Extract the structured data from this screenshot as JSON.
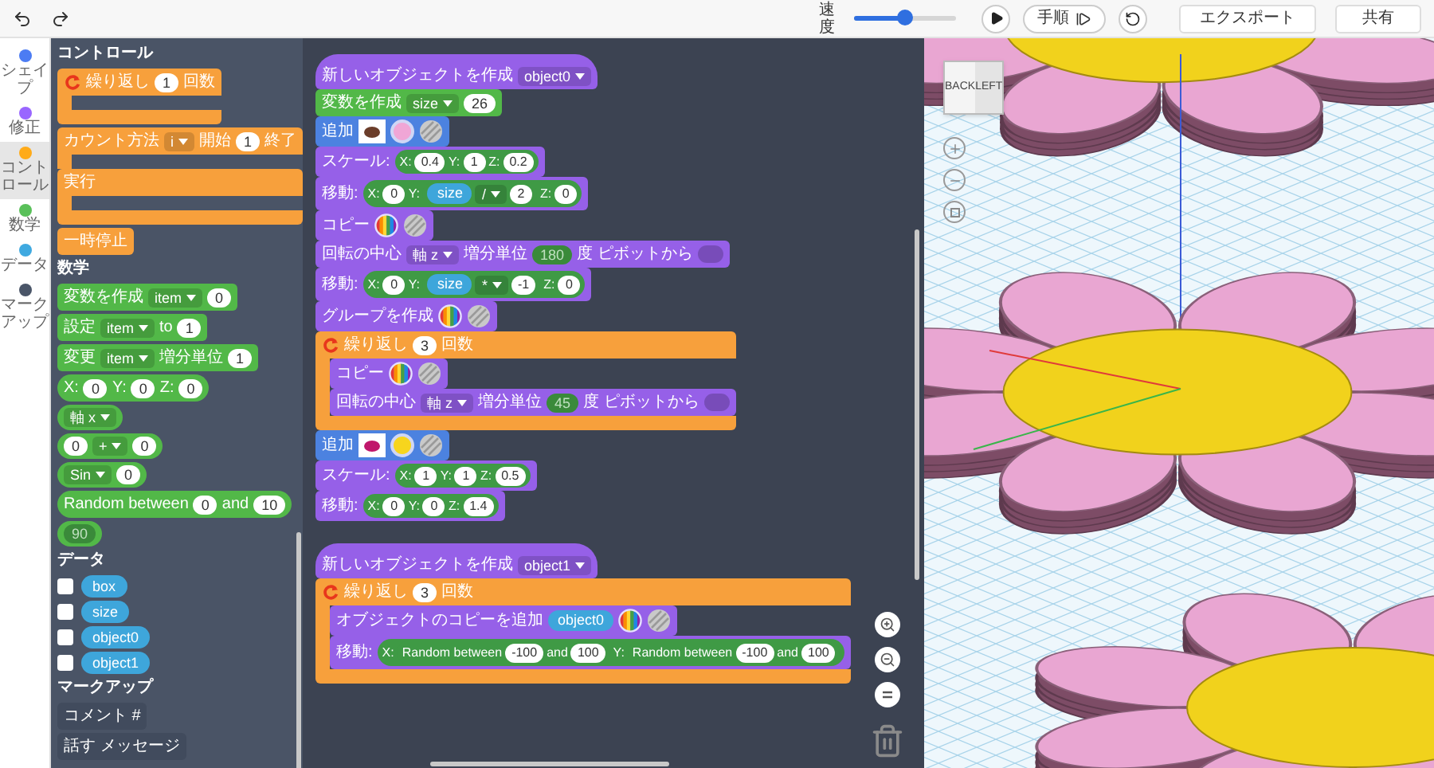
{
  "toolbar": {
    "speed_label": "速度",
    "speed": {
      "level": 0.5
    },
    "step_button": "手順",
    "export_button": "エクスポート",
    "share_button": "共有"
  },
  "categories": [
    {
      "label": "シェイプ",
      "color": "#4c7cf3",
      "selected": false
    },
    {
      "label": "修正",
      "color": "#9966ff",
      "selected": false
    },
    {
      "label": "コントロール",
      "color": "#ffab19",
      "selected": true
    },
    {
      "label": "数学",
      "color": "#59c059",
      "selected": false
    },
    {
      "label": "データ",
      "color": "#3fa9e0",
      "selected": false
    },
    {
      "label": "マークアップ",
      "color": "#4a5568",
      "selected": false
    }
  ],
  "flyout": {
    "sections": [
      {
        "title": "コントロール",
        "items": [
          {
            "kind": "c",
            "color": "#f7a03c",
            "sections": [
              {
                "parts": [
                  {
                    "kind": "loop"
                  },
                  {
                    "kind": "label",
                    "text": "繰り返し"
                  },
                  {
                    "kind": "num",
                    "text": "1"
                  },
                  {
                    "kind": "label",
                    "text": "回数"
                  }
                ]
              }
            ]
          },
          {
            "kind": "c",
            "color": "#f7a03c",
            "sections": [
              {
                "parts": [
                  {
                    "kind": "label",
                    "text": "カウント方法"
                  },
                  {
                    "kind": "dropdown",
                    "text": "i"
                  },
                  {
                    "kind": "label",
                    "text": "開始"
                  },
                  {
                    "kind": "num",
                    "text": "1"
                  },
                  {
                    "kind": "label",
                    "text": "終了"
                  }
                ]
              },
              {
                "parts": [
                  {
                    "kind": "label",
                    "text": "実行"
                  }
                ]
              }
            ]
          },
          {
            "kind": "stack",
            "color": "#f7a03c",
            "parts": [
              {
                "kind": "label",
                "text": "一時停止"
              }
            ]
          }
        ]
      },
      {
        "title": "数学",
        "items": [
          {
            "kind": "stack",
            "color": "#52b848",
            "parts": [
              {
                "kind": "label",
                "text": "変数を作成"
              },
              {
                "kind": "dropdown",
                "text": "item"
              },
              {
                "kind": "num",
                "text": "0"
              }
            ]
          },
          {
            "kind": "stack",
            "color": "#52b848",
            "parts": [
              {
                "kind": "label",
                "text": "設定"
              },
              {
                "kind": "dropdown",
                "text": "item"
              },
              {
                "kind": "label",
                "text": "to"
              },
              {
                "kind": "num",
                "text": "1"
              }
            ]
          },
          {
            "kind": "stack",
            "color": "#52b848",
            "parts": [
              {
                "kind": "label",
                "text": "変更"
              },
              {
                "kind": "dropdown",
                "text": "item"
              },
              {
                "kind": "label",
                "text": "増分単位"
              },
              {
                "kind": "num",
                "text": "1"
              }
            ]
          },
          {
            "kind": "reporter",
            "color": "#52b848",
            "parts": [
              {
                "kind": "label",
                "text": "X:"
              },
              {
                "kind": "num",
                "text": "0"
              },
              {
                "kind": "label",
                "text": "Y:"
              },
              {
                "kind": "num",
                "text": "0"
              },
              {
                "kind": "label",
                "text": "Z:"
              },
              {
                "kind": "num",
                "text": "0"
              }
            ]
          },
          {
            "kind": "reporter",
            "color": "#52b848",
            "parts": [
              {
                "kind": "dropdown",
                "text": "軸 x"
              }
            ]
          },
          {
            "kind": "reporter",
            "color": "#52b848",
            "parts": [
              {
                "kind": "num",
                "text": "0"
              },
              {
                "kind": "dropdown",
                "text": "+"
              },
              {
                "kind": "num",
                "text": "0"
              }
            ]
          },
          {
            "kind": "reporter",
            "color": "#52b848",
            "parts": [
              {
                "kind": "dropdown",
                "text": "Sin"
              },
              {
                "kind": "num",
                "text": "0"
              }
            ]
          },
          {
            "kind": "reporter",
            "color": "#52b848",
            "parts": [
              {
                "kind": "label",
                "text": "Random between"
              },
              {
                "kind": "num",
                "text": "0"
              },
              {
                "kind": "label",
                "text": "and"
              },
              {
                "kind": "num",
                "text": "10"
              }
            ]
          },
          {
            "kind": "reporter",
            "color": "#52b848",
            "parts": [
              {
                "kind": "dnum",
                "text": "90"
              }
            ]
          }
        ]
      },
      {
        "title": "データ",
        "items": [
          {
            "kind": "variable",
            "checked": false,
            "name": "box"
          },
          {
            "kind": "variable",
            "checked": false,
            "name": "size"
          },
          {
            "kind": "variable",
            "checked": false,
            "name": "object0"
          },
          {
            "kind": "variable",
            "checked": false,
            "name": "object1"
          }
        ]
      },
      {
        "title": "マークアップ",
        "items": [
          {
            "kind": "stack",
            "color": "#414b5d",
            "parts": [
              {
                "kind": "label",
                "text": "コメント #"
              }
            ]
          },
          {
            "kind": "stack",
            "color": "#414b5d",
            "parts": [
              {
                "kind": "label",
                "text": "話す"
              },
              {
                "kind": "label",
                "text": "メッセージ"
              }
            ]
          }
        ]
      }
    ]
  },
  "workspace": {
    "stacks": [
      {
        "blocks": [
          {
            "kind": "hat",
            "color": "#9660e8",
            "parts": [
              {
                "kind": "label",
                "text": "新しいオブジェクトを作成"
              },
              {
                "kind": "dropdown",
                "text": "object0"
              }
            ]
          },
          {
            "kind": "stack",
            "color": "#52b848",
            "parts": [
              {
                "kind": "label",
                "text": "変数を作成"
              },
              {
                "kind": "dropdown",
                "text": "size"
              },
              {
                "kind": "num",
                "text": "26"
              }
            ]
          },
          {
            "kind": "stack",
            "color": "#4c82e0",
            "parts": [
              {
                "kind": "label",
                "text": "追加"
              },
              {
                "kind": "thumb",
                "color": "#6b3d2a"
              },
              {
                "kind": "color",
                "color": "#f0a6d6"
              },
              {
                "kind": "hatch"
              }
            ]
          },
          {
            "kind": "stack",
            "color": "#9660e8",
            "parts": [
              {
                "kind": "label",
                "text": "スケール:"
              },
              {
                "kind": "group",
                "parts": [
                  {
                    "kind": "label",
                    "text": "X:"
                  },
                  {
                    "kind": "num",
                    "text": "0.4"
                  },
                  {
                    "kind": "label",
                    "text": "Y:"
                  },
                  {
                    "kind": "num",
                    "text": "1"
                  },
                  {
                    "kind": "label",
                    "text": "Z:"
                  },
                  {
                    "kind": "num",
                    "text": "0.2"
                  }
                ]
              }
            ]
          },
          {
            "kind": "stack",
            "color": "#9660e8",
            "parts": [
              {
                "kind": "label",
                "text": "移動:"
              },
              {
                "kind": "group",
                "parts": [
                  {
                    "kind": "label",
                    "text": "X:"
                  },
                  {
                    "kind": "num",
                    "text": "0"
                  },
                  {
                    "kind": "label",
                    "text": "Y:"
                  },
                  {
                    "kind": "group",
                    "parts": [
                      {
                        "kind": "var",
                        "text": "size"
                      },
                      {
                        "kind": "dropdown",
                        "text": "/"
                      },
                      {
                        "kind": "num",
                        "text": "2"
                      }
                    ]
                  },
                  {
                    "kind": "label",
                    "text": "Z:"
                  },
                  {
                    "kind": "num",
                    "text": "0"
                  }
                ]
              }
            ]
          },
          {
            "kind": "stack",
            "color": "#9660e8",
            "parts": [
              {
                "kind": "label",
                "text": "コピー"
              },
              {
                "kind": "rainbow"
              },
              {
                "kind": "hatch"
              }
            ]
          },
          {
            "kind": "stack",
            "color": "#9660e8",
            "parts": [
              {
                "kind": "label",
                "text": "回転の中心"
              },
              {
                "kind": "dropdown",
                "text": "軸 z"
              },
              {
                "kind": "label",
                "text": "増分単位"
              },
              {
                "kind": "dnum",
                "text": "180"
              },
              {
                "kind": "label",
                "text": "度"
              },
              {
                "kind": "label",
                "text": "ピボットから"
              },
              {
                "kind": "slot"
              }
            ]
          },
          {
            "kind": "stack",
            "color": "#9660e8",
            "parts": [
              {
                "kind": "label",
                "text": "移動:"
              },
              {
                "kind": "group",
                "parts": [
                  {
                    "kind": "label",
                    "text": "X:"
                  },
                  {
                    "kind": "num",
                    "text": "0"
                  },
                  {
                    "kind": "label",
                    "text": "Y:"
                  },
                  {
                    "kind": "group",
                    "parts": [
                      {
                        "kind": "var",
                        "text": "size"
                      },
                      {
                        "kind": "dropdown",
                        "text": "*"
                      },
                      {
                        "kind": "num",
                        "text": "-1"
                      }
                    ]
                  },
                  {
                    "kind": "label",
                    "text": "Z:"
                  },
                  {
                    "kind": "num",
                    "text": "0"
                  }
                ]
              }
            ]
          },
          {
            "kind": "stack",
            "color": "#9660e8",
            "parts": [
              {
                "kind": "label",
                "text": "グループを作成"
              },
              {
                "kind": "rainbow"
              },
              {
                "kind": "hatch"
              }
            ]
          },
          {
            "kind": "c",
            "color": "#f7a03c",
            "sections": [
              {
                "parts": [
                  {
                    "kind": "loop"
                  },
                  {
                    "kind": "label",
                    "text": "繰り返し"
                  },
                  {
                    "kind": "num",
                    "text": "3"
                  },
                  {
                    "kind": "label",
                    "text": "回数"
                  }
                ],
                "inner": [
                  {
                    "kind": "stack",
                    "color": "#9660e8",
                    "parts": [
                      {
                        "kind": "label",
                        "text": "コピー"
                      },
                      {
                        "kind": "rainbow"
                      },
                      {
                        "kind": "hatch"
                      }
                    ]
                  },
                  {
                    "kind": "stack",
                    "color": "#9660e8",
                    "parts": [
                      {
                        "kind": "label",
                        "text": "回転の中心"
                      },
                      {
                        "kind": "dropdown",
                        "text": "軸 z"
                      },
                      {
                        "kind": "label",
                        "text": "増分単位"
                      },
                      {
                        "kind": "dnum",
                        "text": "45"
                      },
                      {
                        "kind": "label",
                        "text": "度"
                      },
                      {
                        "kind": "label",
                        "text": "ピボットから"
                      },
                      {
                        "kind": "slot"
                      }
                    ]
                  }
                ]
              }
            ]
          },
          {
            "kind": "stack",
            "color": "#4c82e0",
            "parts": [
              {
                "kind": "label",
                "text": "追加"
              },
              {
                "kind": "thumb",
                "color": "#c0176b"
              },
              {
                "kind": "color",
                "color": "#f7d51d"
              },
              {
                "kind": "hatch"
              }
            ]
          },
          {
            "kind": "stack",
            "color": "#9660e8",
            "parts": [
              {
                "kind": "label",
                "text": "スケール:"
              },
              {
                "kind": "group",
                "parts": [
                  {
                    "kind": "label",
                    "text": "X:"
                  },
                  {
                    "kind": "num",
                    "text": "1"
                  },
                  {
                    "kind": "label",
                    "text": "Y:"
                  },
                  {
                    "kind": "num",
                    "text": "1"
                  },
                  {
                    "kind": "label",
                    "text": "Z:"
                  },
                  {
                    "kind": "num",
                    "text": "0.5"
                  }
                ]
              }
            ]
          },
          {
            "kind": "stack",
            "color": "#9660e8",
            "parts": [
              {
                "kind": "label",
                "text": "移動:"
              },
              {
                "kind": "group",
                "parts": [
                  {
                    "kind": "label",
                    "text": "X:"
                  },
                  {
                    "kind": "num",
                    "text": "0"
                  },
                  {
                    "kind": "label",
                    "text": "Y:"
                  },
                  {
                    "kind": "num",
                    "text": "0"
                  },
                  {
                    "kind": "label",
                    "text": "Z:"
                  },
                  {
                    "kind": "num",
                    "text": "1.4"
                  }
                ]
              }
            ]
          }
        ]
      },
      {
        "blocks": [
          {
            "kind": "hat",
            "color": "#9660e8",
            "parts": [
              {
                "kind": "label",
                "text": "新しいオブジェクトを作成"
              },
              {
                "kind": "dropdown",
                "text": "object1"
              }
            ]
          },
          {
            "kind": "c",
            "color": "#f7a03c",
            "sections": [
              {
                "parts": [
                  {
                    "kind": "loop"
                  },
                  {
                    "kind": "label",
                    "text": "繰り返し"
                  },
                  {
                    "kind": "num",
                    "text": "3"
                  },
                  {
                    "kind": "label",
                    "text": "回数"
                  }
                ],
                "inner": [
                  {
                    "kind": "stack",
                    "color": "#9660e8",
                    "parts": [
                      {
                        "kind": "label",
                        "text": "オブジェクトのコピーを追加"
                      },
                      {
                        "kind": "var",
                        "text": "object0"
                      },
                      {
                        "kind": "rainbow"
                      },
                      {
                        "kind": "hatch"
                      }
                    ]
                  },
                  {
                    "kind": "stack",
                    "color": "#9660e8",
                    "parts": [
                      {
                        "kind": "label",
                        "text": "移動:"
                      },
                      {
                        "kind": "group",
                        "parts": [
                          {
                            "kind": "label",
                            "text": "X:"
                          },
                          {
                            "kind": "group",
                            "parts": [
                              {
                                "kind": "label",
                                "text": "Random between"
                              },
                              {
                                "kind": "num",
                                "text": "-100"
                              },
                              {
                                "kind": "label",
                                "text": "and"
                              },
                              {
                                "kind": "num",
                                "text": "100"
                              }
                            ]
                          },
                          {
                            "kind": "label",
                            "text": "Y:"
                          },
                          {
                            "kind": "group",
                            "parts": [
                              {
                                "kind": "label",
                                "text": "Random between"
                              },
                              {
                                "kind": "num",
                                "text": "-100"
                              },
                              {
                                "kind": "label",
                                "text": "and"
                              },
                              {
                                "kind": "num",
                                "text": "100"
                              }
                            ]
                          }
                        ]
                      }
                    ]
                  }
                ]
              }
            ]
          }
        ]
      }
    ]
  },
  "viewport": {
    "cube_faces": [
      "BACK",
      "LEFT"
    ]
  }
}
